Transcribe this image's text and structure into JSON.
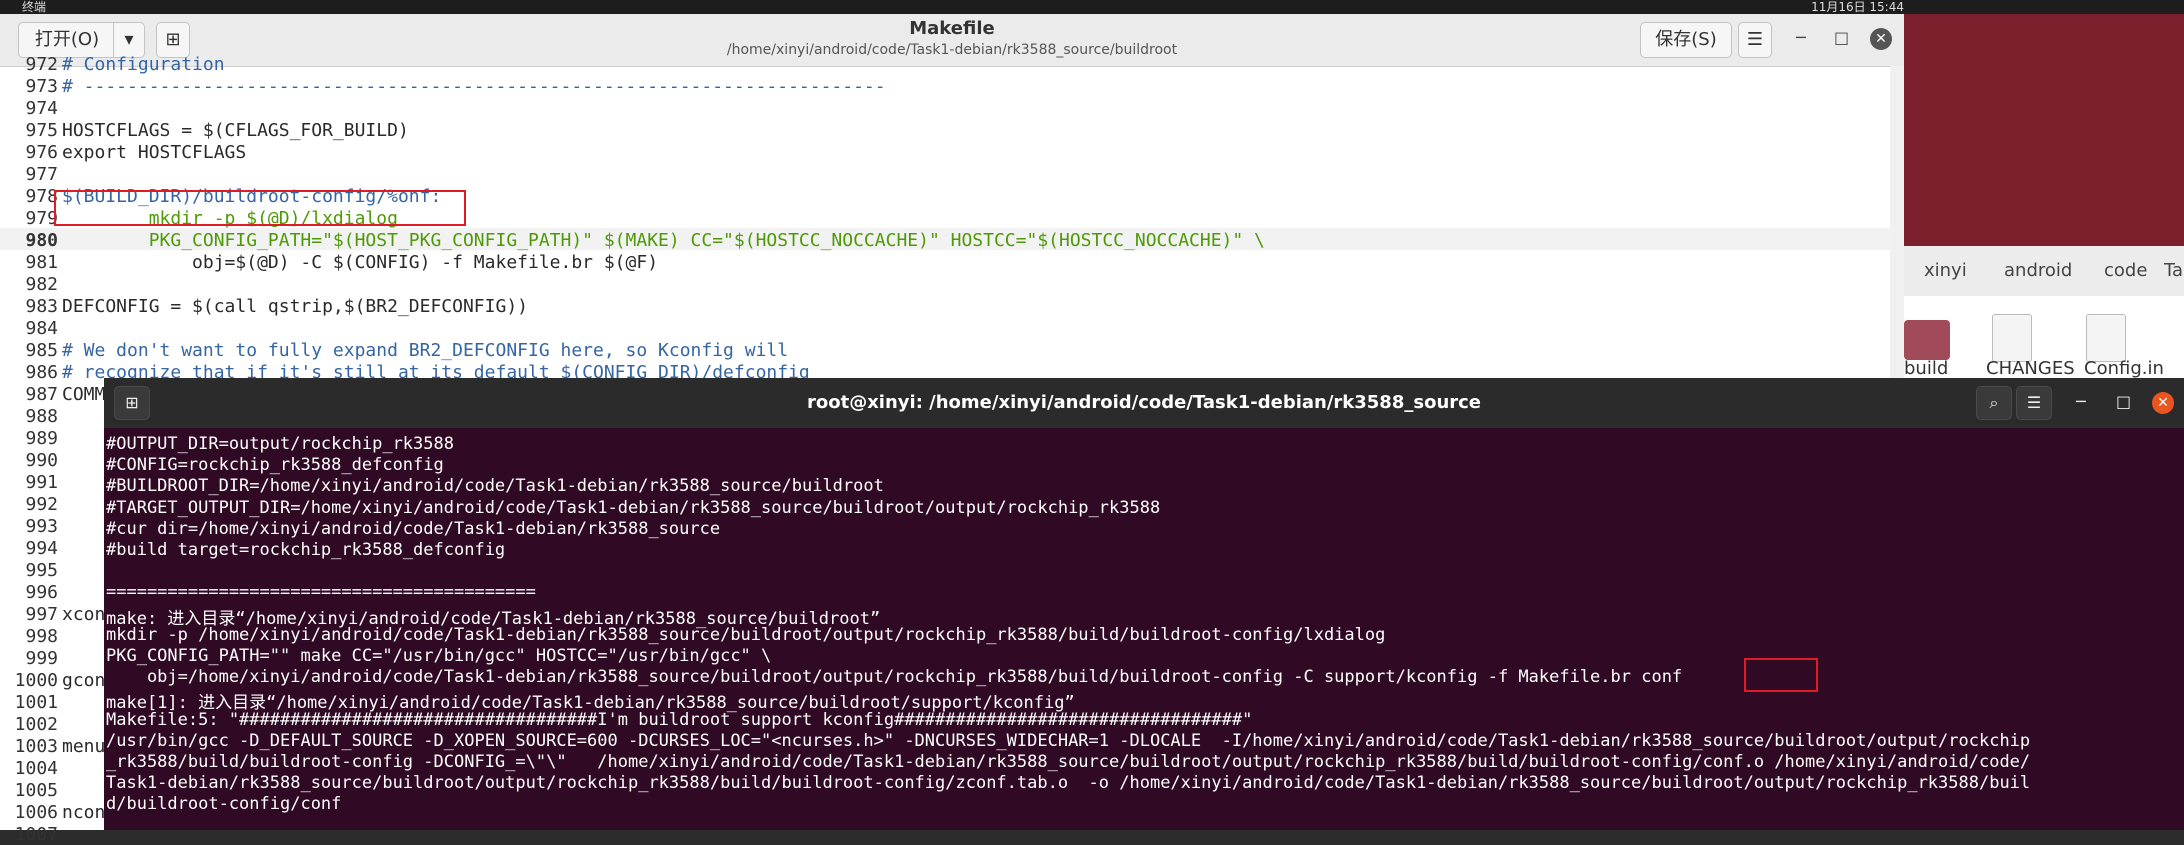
{
  "system_bar": {
    "left": "终端",
    "right": "11月16日 15:44"
  },
  "file_manager": {
    "breadcrumbs": [
      "xinyi",
      "android",
      "code",
      "Ta"
    ],
    "files": [
      "build",
      "CHANGES",
      "Config.in"
    ]
  },
  "gedit": {
    "open_label": "打开(O)",
    "save_label": "保存(S)",
    "title": "Makefile",
    "path": "/home/xinyi/android/code/Task1-debian/rk3588_source/buildroot",
    "lines": [
      {
        "n": "972",
        "t": "# Configuration"
      },
      {
        "n": "973",
        "t": "# --------------------------------------------------------------------------"
      },
      {
        "n": "974",
        "t": ""
      },
      {
        "n": "975",
        "t": "HOSTCFLAGS = $(CFLAGS_FOR_BUILD)"
      },
      {
        "n": "976",
        "t": "export HOSTCFLAGS"
      },
      {
        "n": "977",
        "t": ""
      },
      {
        "n": "978",
        "t": "$(BUILD_DIR)/buildroot-config/%onf:"
      },
      {
        "n": "979",
        "t": "        mkdir -p $(@D)/lxdialog"
      },
      {
        "n": "980",
        "t": "        PKG_CONFIG_PATH=\"$(HOST_PKG_CONFIG_PATH)\" $(MAKE) CC=\"$(HOSTCC_NOCCACHE)\" HOSTCC=\"$(HOSTCC_NOCCACHE)\" \\"
      },
      {
        "n": "981",
        "t": "            obj=$(@D) -C $(CONFIG) -f Makefile.br $(@F)"
      },
      {
        "n": "982",
        "t": ""
      },
      {
        "n": "983",
        "t": "DEFCONFIG = $(call qstrip,$(BR2_DEFCONFIG))"
      },
      {
        "n": "984",
        "t": ""
      },
      {
        "n": "985",
        "t": "# We don't want to fully expand BR2_DEFCONFIG here, so Kconfig will"
      },
      {
        "n": "986",
        "t": "# recognize that if it's still at its default $(CONFIG_DIR)/defconfig"
      },
      {
        "n": "987",
        "t": "COMM"
      },
      {
        "n": "988",
        "t": ""
      },
      {
        "n": "989",
        "t": ""
      },
      {
        "n": "990",
        "t": ""
      },
      {
        "n": "991",
        "t": ""
      },
      {
        "n": "992",
        "t": ""
      },
      {
        "n": "993",
        "t": ""
      },
      {
        "n": "994",
        "t": ""
      },
      {
        "n": "995",
        "t": ""
      },
      {
        "n": "996",
        "t": ""
      },
      {
        "n": "997",
        "t": "xcon"
      },
      {
        "n": "998",
        "t": ""
      },
      {
        "n": "999",
        "t": ""
      },
      {
        "n": "1000",
        "t": "gcon"
      },
      {
        "n": "1001",
        "t": ""
      },
      {
        "n": "1002",
        "t": ""
      },
      {
        "n": "1003",
        "t": "menu"
      },
      {
        "n": "1004",
        "t": ""
      },
      {
        "n": "1005",
        "t": ""
      },
      {
        "n": "1006",
        "t": "ncon"
      },
      {
        "n": "1007",
        "t": ""
      }
    ]
  },
  "terminal": {
    "title": "root@xinyi: /home/xinyi/android/code/Task1-debian/rk3588_source",
    "lines": [
      "#OUTPUT_DIR=output/rockchip_rk3588",
      "#CONFIG=rockchip_rk3588_defconfig",
      "#BUILDROOT_DIR=/home/xinyi/android/code/Task1-debian/rk3588_source/buildroot",
      "#TARGET_OUTPUT_DIR=/home/xinyi/android/code/Task1-debian/rk3588_source/buildroot/output/rockchip_rk3588",
      "#cur dir=/home/xinyi/android/code/Task1-debian/rk3588_source",
      "#build target=rockchip_rk3588_defconfig",
      "",
      "==========================================",
      "make: 进入目录“/home/xinyi/android/code/Task1-debian/rk3588_source/buildroot”",
      "mkdir -p /home/xinyi/android/code/Task1-debian/rk3588_source/buildroot/output/rockchip_rk3588/build/buildroot-config/lxdialog",
      "PKG_CONFIG_PATH=\"\" make CC=\"/usr/bin/gcc\" HOSTCC=\"/usr/bin/gcc\" \\",
      "    obj=/home/xinyi/android/code/Task1-debian/rk3588_source/buildroot/output/rockchip_rk3588/build/buildroot-config -C support/kconfig -f Makefile.br conf",
      "make[1]: 进入目录“/home/xinyi/android/code/Task1-debian/rk3588_source/buildroot/support/kconfig”",
      "Makefile:5: \"###################################I'm buildroot support kconfig##################################\"",
      "/usr/bin/gcc -D_DEFAULT_SOURCE -D_XOPEN_SOURCE=600 -DCURSES_LOC=\"<ncurses.h>\" -DNCURSES_WIDECHAR=1 -DLOCALE  -I/home/xinyi/android/code/Task1-debian/rk3588_source/buildroot/output/rockchip",
      "_rk3588/build/buildroot-config -DCONFIG_=\\\"\\\"   /home/xinyi/android/code/Task1-debian/rk3588_source/buildroot/output/rockchip_rk3588/build/buildroot-config/conf.o /home/xinyi/android/code/",
      "Task1-debian/rk3588_source/buildroot/output/rockchip_rk3588/build/buildroot-config/zconf.tab.o  -o /home/xinyi/android/code/Task1-debian/rk3588_source/buildroot/output/rockchip_rk3588/buil",
      "d/buildroot-config/conf"
    ]
  }
}
